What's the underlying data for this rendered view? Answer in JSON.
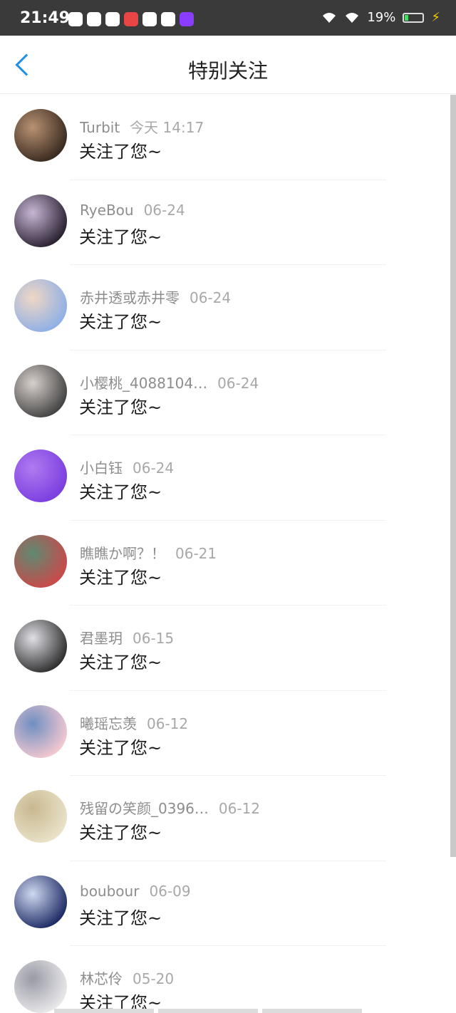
{
  "status": {
    "time": "21:49",
    "battery": "19%",
    "battery_level": 0.19,
    "notif_colors": [
      "#ffffff",
      "#ffffff",
      "#ffffff",
      "#e84545",
      "#ffffff",
      "#ffffff",
      "#8a3cff"
    ]
  },
  "nav": {
    "title": "特别关注",
    "back_icon": "chevron-left-icon"
  },
  "items": [
    {
      "name": "Turbit",
      "date": "今天 14:17",
      "message": "关注了您~",
      "colors": [
        "#3a2a20",
        "#b89272"
      ]
    },
    {
      "name": "RyeBou",
      "date": "06-24",
      "message": "关注了您~",
      "colors": [
        "#2b2232",
        "#c7b7d6"
      ]
    },
    {
      "name": "赤井透或赤井零",
      "date": "06-24",
      "message": "关注了您~",
      "colors": [
        "#8fb0e6",
        "#f0d7c4"
      ]
    },
    {
      "name": "小樱桃_4088104…",
      "date": "06-24",
      "message": "关注了您~",
      "colors": [
        "#444444",
        "#d8d0cc"
      ]
    },
    {
      "name": "小白钰",
      "date": "06-24",
      "message": "关注了您~",
      "colors": [
        "#7a3fe0",
        "#b07af0"
      ]
    },
    {
      "name": "瞧瞧か啊？！",
      "date": "06-21",
      "message": "关注了您~",
      "colors": [
        "#c94a4a",
        "#5e8a72"
      ]
    },
    {
      "name": "君墨玥",
      "date": "06-15",
      "message": "关注了您~",
      "colors": [
        "#303030",
        "#e0e0e6"
      ]
    },
    {
      "name": "曦瑶忘羡",
      "date": "06-12",
      "message": "关注了您~",
      "colors": [
        "#f2c7d0",
        "#6f8fc2"
      ]
    },
    {
      "name": "残留の笑颜_0396…",
      "date": "06-12",
      "message": "关注了您~",
      "colors": [
        "#e9e2c8",
        "#c8b890"
      ]
    },
    {
      "name": "boubour",
      "date": "06-09",
      "message": "关注了您~",
      "colors": [
        "#1f2d66",
        "#cfd8f0"
      ]
    },
    {
      "name": "林芯伶",
      "date": "05-20",
      "message": "关注了您~",
      "colors": [
        "#e8e8ea",
        "#9a9aa6"
      ]
    }
  ]
}
